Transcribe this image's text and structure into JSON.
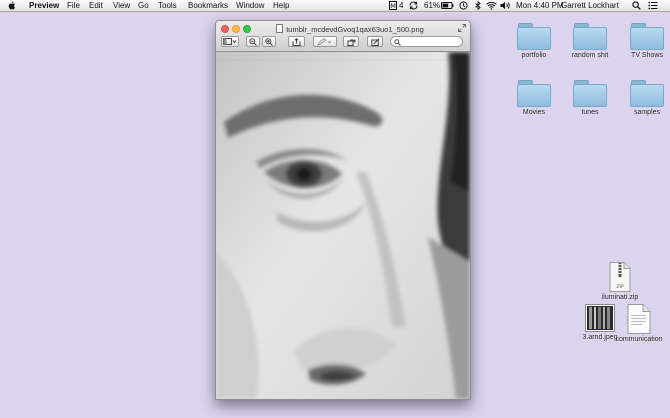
{
  "menubar": {
    "app_name": "Preview",
    "menus": [
      "File",
      "Edit",
      "View",
      "Go",
      "Tools",
      "Bookmarks",
      "Window",
      "Help"
    ],
    "status": {
      "adobe_count": "4",
      "battery": "61%",
      "clock": "Mon 4:40 PM",
      "user": "Garrett Lockhart"
    }
  },
  "window": {
    "title": "tumblr_mcdevdGvoq1qax63uo1_500.png",
    "search": {
      "value": "",
      "placeholder": ""
    }
  },
  "desktop": {
    "folders": [
      "portfolio",
      "random shit",
      "TV Shows",
      "Movies",
      "tunes",
      "samples"
    ],
    "files": [
      {
        "label": "iluminati.zip",
        "badge": "ZIP"
      },
      {
        "label": "3.arnd.jpeg"
      },
      {
        "label": "communication"
      }
    ]
  }
}
